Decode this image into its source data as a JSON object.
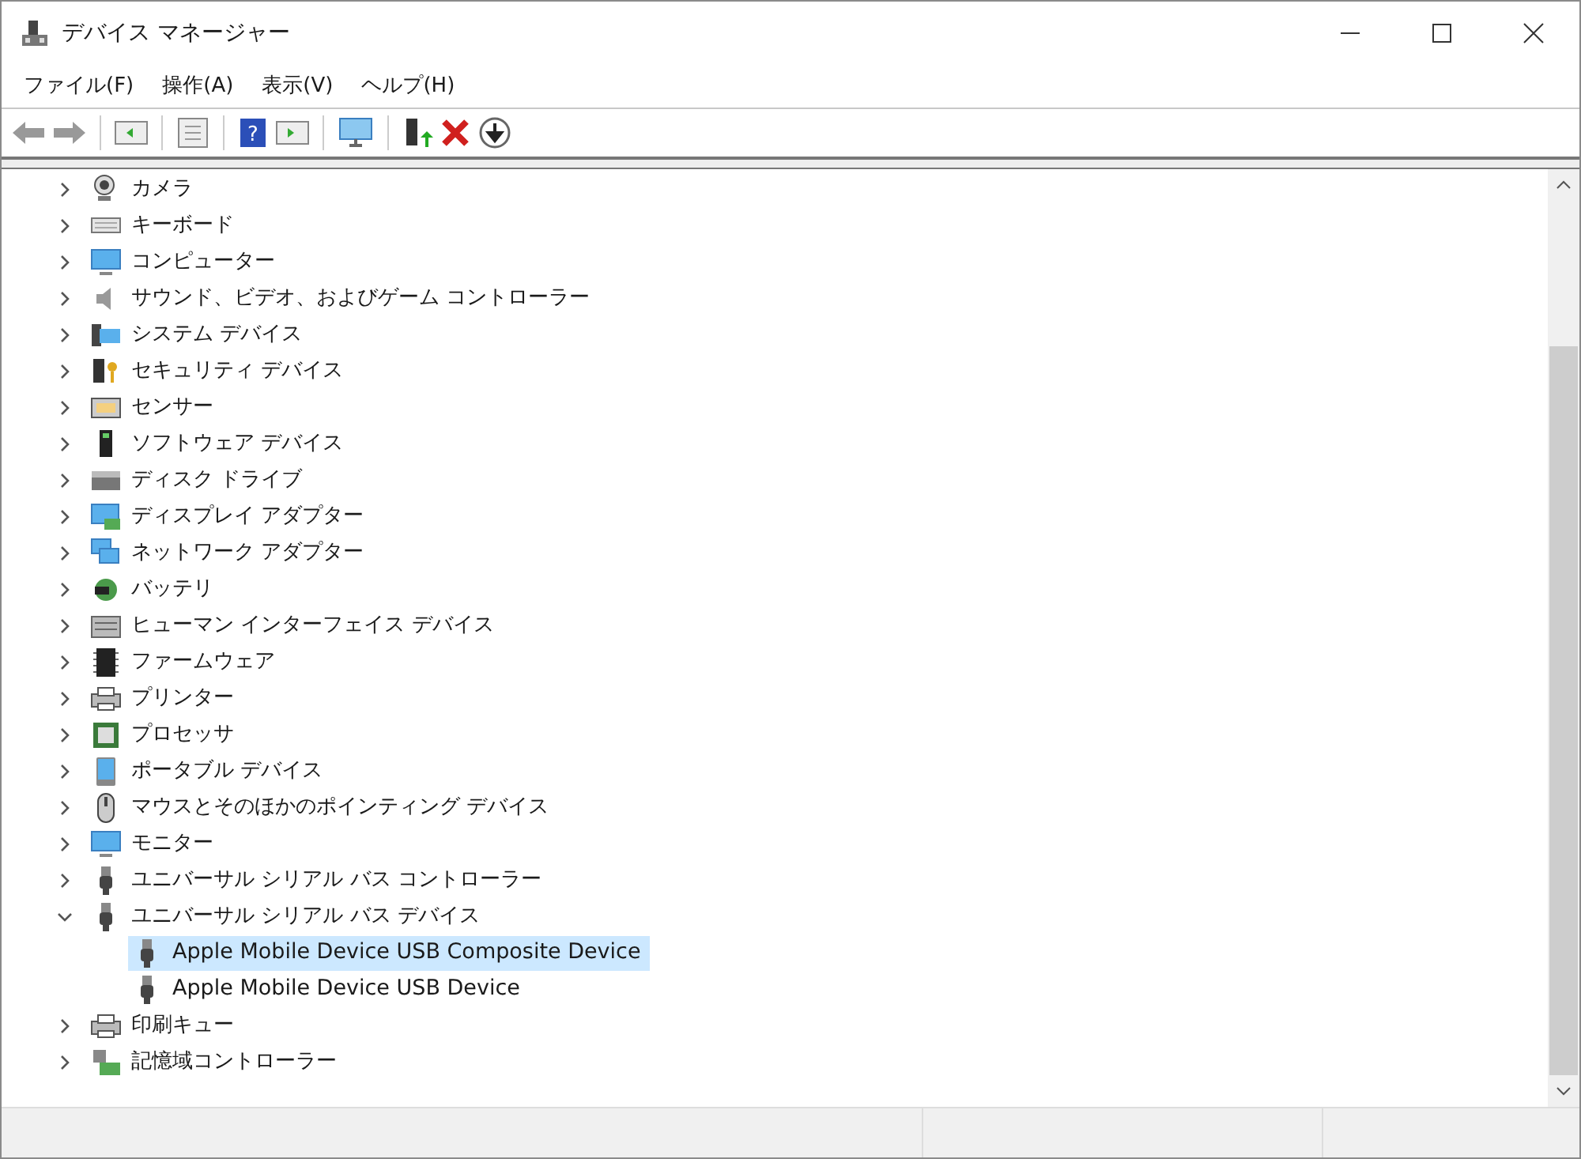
{
  "window": {
    "title": "デバイス マネージャー"
  },
  "toolbar": {
    "help_glyph": "?"
  },
  "menu": [
    "ファイル(F)",
    "操作(A)",
    "表示(V)",
    "ヘルプ(H)"
  ],
  "tree": [
    {
      "label": "カメラ",
      "expanded": false
    },
    {
      "label": "キーボード",
      "expanded": false
    },
    {
      "label": "コンピューター",
      "expanded": false
    },
    {
      "label": "サウンド、ビデオ、およびゲーム コントローラー",
      "expanded": false
    },
    {
      "label": "システム デバイス",
      "expanded": false
    },
    {
      "label": "セキュリティ デバイス",
      "expanded": false
    },
    {
      "label": "センサー",
      "expanded": false
    },
    {
      "label": "ソフトウェア デバイス",
      "expanded": false
    },
    {
      "label": "ディスク ドライブ",
      "expanded": false
    },
    {
      "label": "ディスプレイ アダプター",
      "expanded": false
    },
    {
      "label": "ネットワーク アダプター",
      "expanded": false
    },
    {
      "label": "バッテリ",
      "expanded": false
    },
    {
      "label": "ヒューマン インターフェイス デバイス",
      "expanded": false
    },
    {
      "label": "ファームウェア",
      "expanded": false
    },
    {
      "label": "プリンター",
      "expanded": false
    },
    {
      "label": "プロセッサ",
      "expanded": false
    },
    {
      "label": "ポータブル デバイス",
      "expanded": false
    },
    {
      "label": "マウスとそのほかのポインティング デバイス",
      "expanded": false
    },
    {
      "label": "モニター",
      "expanded": false
    },
    {
      "label": "ユニバーサル シリアル バス コントローラー",
      "expanded": false
    },
    {
      "label": "ユニバーサル シリアル バス デバイス",
      "expanded": true,
      "children": [
        {
          "label": "Apple Mobile Device USB Composite Device",
          "selected": true
        },
        {
          "label": "Apple Mobile Device USB Device",
          "selected": false
        }
      ]
    },
    {
      "label": "印刷キュー",
      "expanded": false
    },
    {
      "label": "記憶域コントローラー",
      "expanded": false
    }
  ]
}
